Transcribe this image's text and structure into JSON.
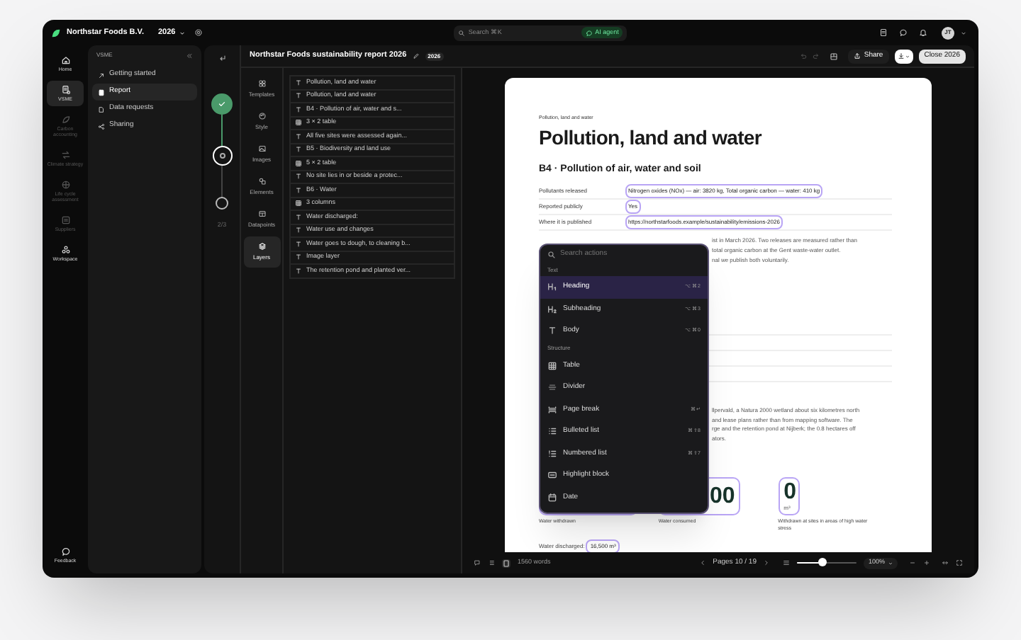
{
  "top_bar": {
    "org": "Northstar Foods B.V.",
    "year": "2026",
    "search_placeholder": "Search ⌘K",
    "ai_button": "AI agent",
    "avatar": "JT"
  },
  "rail": [
    {
      "kind": "home",
      "label": "Home",
      "selected": false,
      "disabled": false
    },
    {
      "kind": "vsme",
      "label": "VSME",
      "selected": true,
      "disabled": false
    },
    {
      "kind": "carbon",
      "label": "Carbon accounting",
      "selected": false,
      "disabled": true
    },
    {
      "kind": "strategy",
      "label": "Climate strategy",
      "selected": false,
      "disabled": true
    },
    {
      "kind": "lca",
      "label": "Life cycle assessment",
      "selected": false,
      "disabled": true
    },
    {
      "kind": "suppliers",
      "label": "Suppliers",
      "selected": false,
      "disabled": true
    },
    {
      "kind": "workspace",
      "label": "Workspace",
      "selected": false,
      "disabled": false
    }
  ],
  "feedback": "Feedback",
  "nav": {
    "title": "VSME",
    "items": [
      {
        "kind": "start",
        "label": "Getting started",
        "selected": false
      },
      {
        "kind": "report",
        "label": "Report",
        "selected": true
      },
      {
        "kind": "requests",
        "label": "Data requests",
        "selected": false
      },
      {
        "kind": "sharing",
        "label": "Sharing",
        "selected": false
      }
    ]
  },
  "steps": [
    {
      "completed": true,
      "current": false
    },
    {
      "completed": false,
      "current": true
    },
    {
      "completed": false,
      "current": false
    }
  ],
  "step_count": "2/3",
  "document": {
    "title": "Northstar Foods sustainability report 2026",
    "year": "2026",
    "share": "Share",
    "close": "Close 2026"
  },
  "tools": [
    {
      "kind": "templates",
      "label": "Templates",
      "selected": false
    },
    {
      "kind": "style",
      "label": "Style",
      "selected": false
    },
    {
      "kind": "images",
      "label": "Images",
      "selected": false
    },
    {
      "kind": "elements",
      "label": "Elements",
      "selected": false
    },
    {
      "kind": "datapoints",
      "label": "Datapoints",
      "selected": false
    },
    {
      "kind": "layers",
      "label": "Layers",
      "selected": true
    }
  ],
  "layers": [
    {
      "kind": "text",
      "label": "Pollution, land and water"
    },
    {
      "kind": "text",
      "label": "Pollution, land and water"
    },
    {
      "kind": "text",
      "label": "B4 · Pollution of air, water and s..."
    },
    {
      "kind": "table",
      "label": "3 × 2 table"
    },
    {
      "kind": "text",
      "label": "All five sites were assessed again..."
    },
    {
      "kind": "text",
      "label": "B5 · Biodiversity and land use"
    },
    {
      "kind": "table",
      "label": "5 × 2 table"
    },
    {
      "kind": "text",
      "label": "No site lies in or beside a protec..."
    },
    {
      "kind": "text",
      "label": "B6 · Water"
    },
    {
      "kind": "table",
      "label": "3 columns"
    },
    {
      "kind": "text",
      "label": "Water discharged:"
    },
    {
      "kind": "text",
      "label": "Water use and changes"
    },
    {
      "kind": "text",
      "label": "Water goes to dough, to cleaning b..."
    },
    {
      "kind": "text",
      "label": "Image layer"
    },
    {
      "kind": "text",
      "label": "The retention pond and planted ver..."
    }
  ],
  "page": {
    "kicker": "Pollution, land and water",
    "title": "Pollution, land and water",
    "section": "B4 · Pollution of air, water and soil",
    "fields": [
      {
        "label": "Pollutants released",
        "value": "Nitrogen oxides (NOx) — air: 3820 kg, Total organic carbon — water: 410 kg"
      },
      {
        "label": "Reported publicly",
        "value": "Yes"
      },
      {
        "label": "Where it is published",
        "value": "https://northstarfoods.example/sustainability/emissions-2026"
      }
    ],
    "paragraph_1": [
      "ist in March 2026. Two releases are measured rather than",
      "total organic carbon at the Gent waste-water outlet.",
      "nal we publish both voluntarily."
    ],
    "paragraph_2": [
      "llpervald, a Natura 2000 wetland about six kilometres north",
      "and lease plans rather than from mapping software. The",
      "rge and the retention pond at Nijberk; the 0.8 hectares off",
      "ators."
    ],
    "metrics": [
      {
        "label": "Water withdrawn"
      },
      {
        "value": "00",
        "label": "Water consumed"
      },
      {
        "value": "0",
        "unit": "m³",
        "label": "Withdrawn at sites in areas of high water stress"
      }
    ],
    "discharged": {
      "label": "Water discharged:",
      "value": "16,500 m³"
    }
  },
  "action_menu": {
    "placeholder": "Search actions",
    "sections": [
      {
        "title": "Text",
        "items": [
          {
            "kind": "h1",
            "label": "Heading",
            "shortcut": "⌥⌘2",
            "selected": true
          },
          {
            "kind": "h2",
            "label": "Subheading",
            "shortcut": "⌥⌘3",
            "selected": false
          },
          {
            "kind": "body",
            "label": "Body",
            "shortcut": "⌥⌘0",
            "selected": false
          }
        ]
      },
      {
        "title": "Structure",
        "items": [
          {
            "kind": "table",
            "label": "Table",
            "selected": false
          },
          {
            "kind": "divider",
            "label": "Divider",
            "selected": false
          },
          {
            "kind": "pagebreak",
            "label": "Page break",
            "shortcut": "⌘↵",
            "selected": false
          },
          {
            "kind": "bullets",
            "label": "Bulleted list",
            "shortcut": "⌘⇧8",
            "selected": false
          },
          {
            "kind": "numbers",
            "label": "Numbered list",
            "shortcut": "⌘⇧7",
            "selected": false
          },
          {
            "kind": "highlight",
            "label": "Highlight block",
            "selected": false
          },
          {
            "kind": "date",
            "label": "Date",
            "selected": false
          }
        ]
      }
    ]
  },
  "status_bar": {
    "words": "1560 words",
    "pages": "Pages 10 / 19",
    "zoom_slider": {
      "level": 0.42
    },
    "zoom": "100%"
  }
}
